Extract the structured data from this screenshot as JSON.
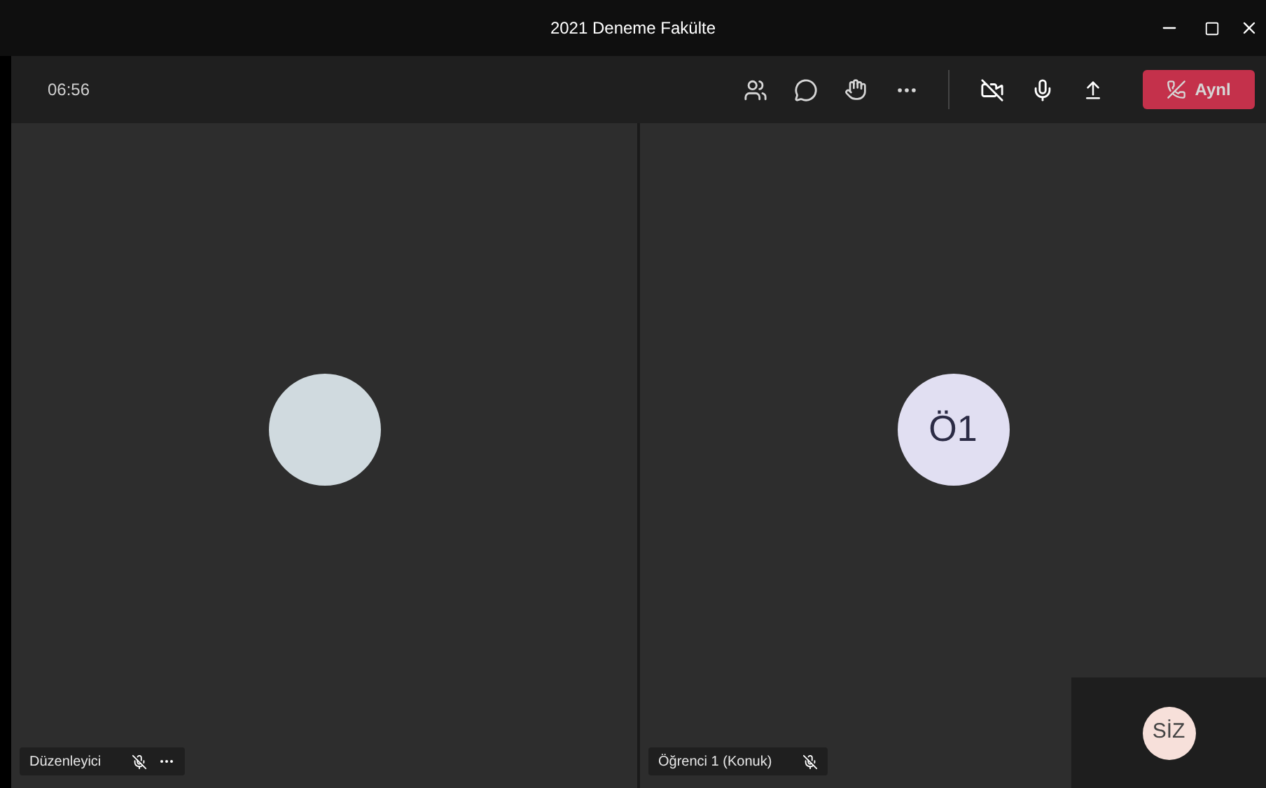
{
  "window": {
    "title": "2021 Deneme Fakülte"
  },
  "toolbar": {
    "timer": "06:56",
    "camera_on": false,
    "leave_label": "Aynl"
  },
  "participants": [
    {
      "name": "Düzenleyici",
      "muted": true,
      "has_more": true
    },
    {
      "name": "Öğrenci 1 (Konuk)",
      "muted": true,
      "avatar": "Ö1",
      "has_more": false
    }
  ],
  "self_view": {
    "avatar": "SİZ"
  }
}
